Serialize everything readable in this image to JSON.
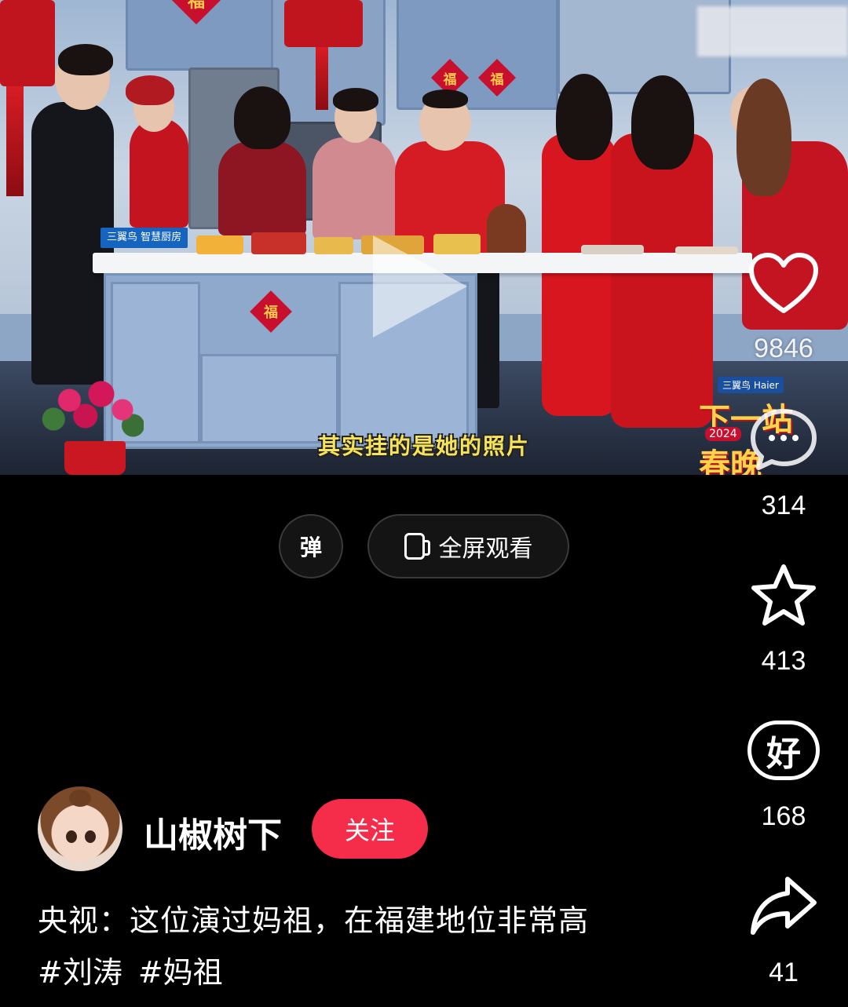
{
  "video": {
    "subtitle": "其实挂的是她的照片",
    "sponsor_label": "三翼鸟 智慧厨房",
    "logo_brand": "三翼鸟 Haier",
    "logo_title": "下一站春晚",
    "logo_year": "2024",
    "fu_char": "福",
    "like_count_overlay": "9846"
  },
  "controls": {
    "danmu_label": "弹",
    "fullscreen_label": "全屏观看"
  },
  "actions": {
    "comment_count": "314",
    "favorite_count": "413",
    "good_count": "168",
    "good_label": "好",
    "share_count": "41"
  },
  "author": {
    "name": "山椒树下",
    "follow_label": "关注"
  },
  "post": {
    "caption": "央视：这位演过妈祖，在福建地位非常高",
    "tags": [
      "#刘涛",
      "#妈祖"
    ]
  },
  "colors": {
    "follow_button": "#f52d4a",
    "subtitle": "#f7e35a",
    "background": "#000000"
  }
}
